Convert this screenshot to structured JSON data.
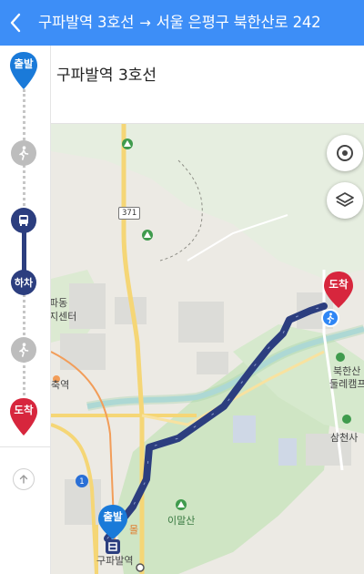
{
  "header": {
    "origin": "구파발역 3호선",
    "arrow": "→",
    "destination": "서울 은평구 북한산로 242"
  },
  "step": {
    "text": "구파발역 3호선"
  },
  "timeline": {
    "start_label": "출발",
    "alight_label": "하차",
    "end_label": "도착",
    "steps": [
      "walk-icon",
      "bus-icon",
      "walk-icon"
    ]
  },
  "map": {
    "labels": {
      "station": "구파발역",
      "station_left": "축역",
      "center_line1": "파동",
      "center_line2": "지센터",
      "imalsan": "이말산",
      "bukhan_line1": "북한산",
      "bukhan_line2": "둘레캠프",
      "samcheon": "삼천사",
      "mall": "몰"
    },
    "road_badges": {
      "r371": "371",
      "r1": "1"
    },
    "start_label": "출발",
    "end_label": "도착",
    "colors": {
      "route": "#2c3e7f",
      "start_pin": "#1a7ad9",
      "end_pin": "#d7263d",
      "header": "#3d8ef7"
    }
  }
}
